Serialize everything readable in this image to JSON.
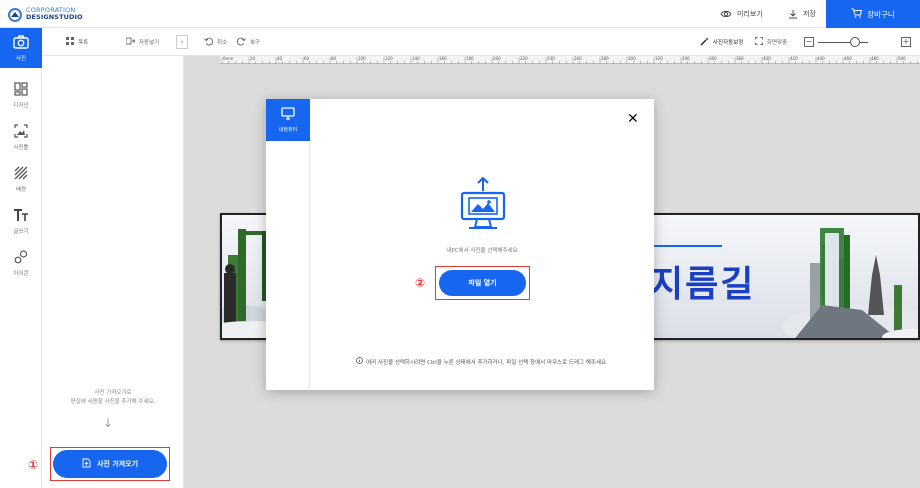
{
  "header": {
    "logo_line1": "CORPORATION",
    "logo_line2": "DESIGNSTUDIO",
    "preview_label": "미리보기",
    "save_label": "저장",
    "cart_label": "장바구니"
  },
  "rail": {
    "items": [
      {
        "label": "사진",
        "icon": "camera-icon"
      },
      {
        "label": "디자인",
        "icon": "layout-icon"
      },
      {
        "label": "사진틀",
        "icon": "frame-icon"
      },
      {
        "label": "배경",
        "icon": "pattern-icon"
      },
      {
        "label": "글쓰기",
        "icon": "text-icon"
      },
      {
        "label": "아이콘",
        "icon": "shapes-icon"
      }
    ]
  },
  "panel": {
    "hint_line1": "사진 가져오기로",
    "hint_line2": "편집에 사용할 사진을 추가해 주세요.",
    "import_label": "사진 가져오기"
  },
  "toolbar": {
    "list_label": "목록",
    "auto_fill_label": "자동넣기",
    "undo_label": "취소",
    "redo_label": "복구",
    "auto_correct_label": "사진자동보정",
    "fit_screen_label": "화면맞춤"
  },
  "ruler": {
    "marks": [
      "0mm",
      "20",
      "40",
      "60",
      "80",
      "100",
      "120",
      "140",
      "160",
      "180",
      "200",
      "220",
      "240",
      "260",
      "280",
      "300",
      "320",
      "340",
      "360",
      "380",
      "400",
      "420",
      "440",
      "460",
      "480",
      "500"
    ]
  },
  "canvas": {
    "banner_text": "지름길"
  },
  "modal": {
    "tab_label": "내컴퓨터",
    "description": "내PC에서 사진을 선택해주세요",
    "open_label": "파일 열기",
    "note": "여러 사진을 선택하시려면 Ctrl을 누른 상태에서 추가하거나, 파일 선택 창에서 마우스로 드래그 해주세요."
  },
  "annotations": {
    "badge1": "①",
    "badge2": "②"
  },
  "colors": {
    "accent": "#1666f0",
    "highlight": "#e53935"
  }
}
